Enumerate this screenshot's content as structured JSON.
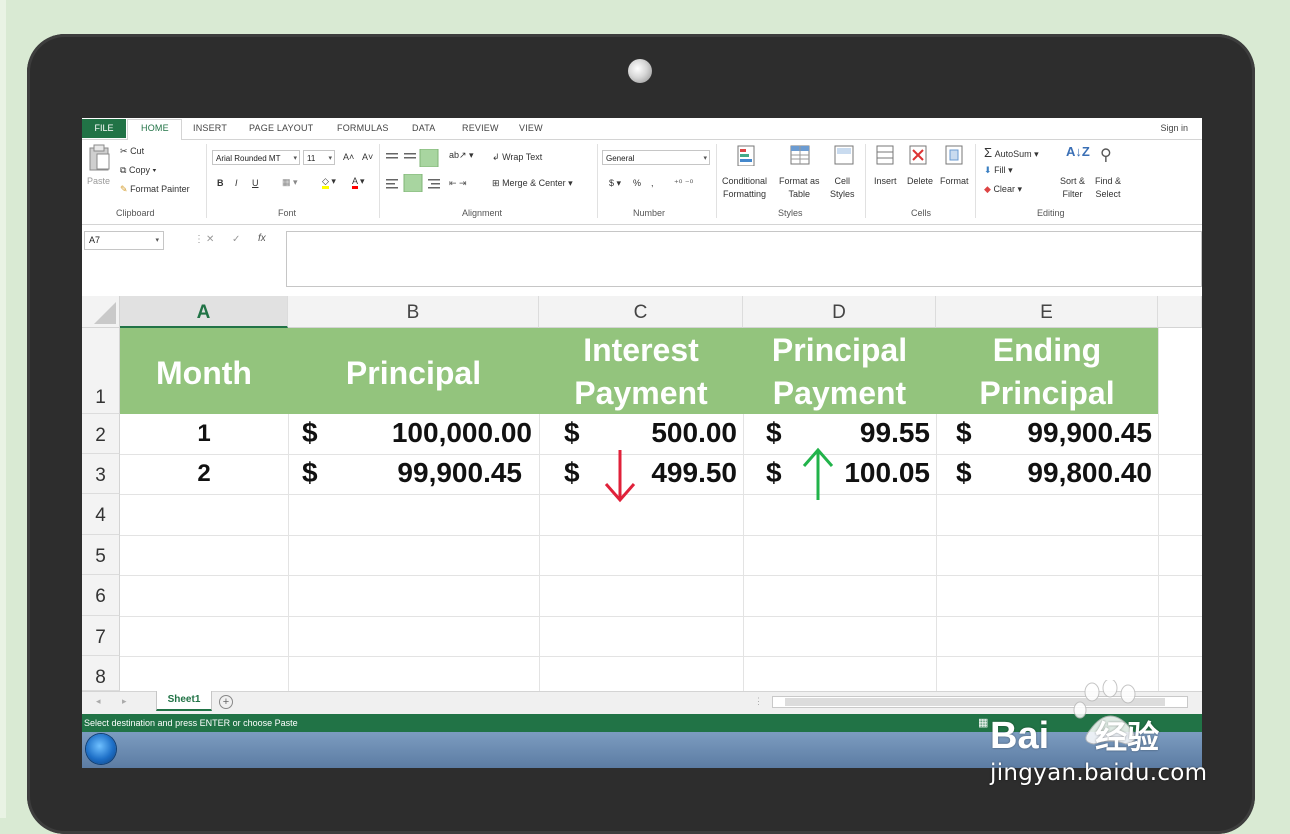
{
  "ribbon_tabs": [
    "FILE",
    "HOME",
    "INSERT",
    "PAGE LAYOUT",
    "FORMULAS",
    "DATA",
    "REVIEW",
    "VIEW"
  ],
  "sign_in": "Sign in",
  "clipboard": {
    "paste": "Paste",
    "cut": "Cut",
    "copy": "Copy",
    "format_painter": "Format Painter",
    "label": "Clipboard"
  },
  "font": {
    "name": "Arial Rounded MT",
    "size": "11",
    "label": "Font",
    "bold": "B",
    "italic": "I",
    "underline": "U"
  },
  "alignment": {
    "wrap_text": "Wrap Text",
    "merge_center": "Merge & Center",
    "label": "Alignment"
  },
  "number": {
    "format": "General",
    "currency": "$",
    "percent": "%",
    "label": "Number"
  },
  "styles": {
    "conditional": "Conditional\nFormatting",
    "format_as_table": "Format as\nTable",
    "cell_styles": "Cell\nStyles",
    "label": "Styles"
  },
  "cells": {
    "insert": "Insert",
    "delete": "Delete",
    "format": "Format",
    "label": "Cells"
  },
  "editing": {
    "autosum": "AutoSum",
    "fill": "Fill",
    "clear": "Clear",
    "sort_filter": "Sort &\nFilter",
    "find_select": "Find &\nSelect",
    "label": "Editing"
  },
  "name_box": "A7",
  "columns": [
    "A",
    "B",
    "C",
    "D",
    "E"
  ],
  "rows": [
    "1",
    "2",
    "3",
    "4",
    "5",
    "6",
    "7",
    "8"
  ],
  "headers": {
    "month": "Month",
    "principal": "Principal",
    "interest_payment_1": "Interest",
    "interest_payment_2": "Payment",
    "principal_payment_1": "Principal",
    "principal_payment_2": "Payment",
    "ending_principal_1": "Ending",
    "ending_principal_2": "Principal"
  },
  "data_rows": [
    {
      "month": "1",
      "principal_cur": "$",
      "principal": "100,000.00",
      "interest_cur": "$",
      "interest": "500.00",
      "pp_cur": "$",
      "principal_payment": "99.55",
      "ep_cur": "$",
      "ending_principal": "99,900.45"
    },
    {
      "month": "2",
      "principal_cur": "$",
      "principal": "99,900.45",
      "interest_cur": "$",
      "interest": "499.50",
      "pp_cur": "$",
      "principal_payment": "100.05",
      "ep_cur": "$",
      "ending_principal": "99,800.40"
    }
  ],
  "sheet_tab": "Sheet1",
  "status_text": "Select destination and press ENTER or choose Paste",
  "watermark": {
    "brand": "Bai",
    "brand2": "经验",
    "url": "jingyan.baidu.com"
  },
  "colors": {
    "excel_green": "#217346",
    "header_fill": "#93c47d",
    "down_arrow": "#e0213a",
    "up_arrow": "#21b34a"
  }
}
